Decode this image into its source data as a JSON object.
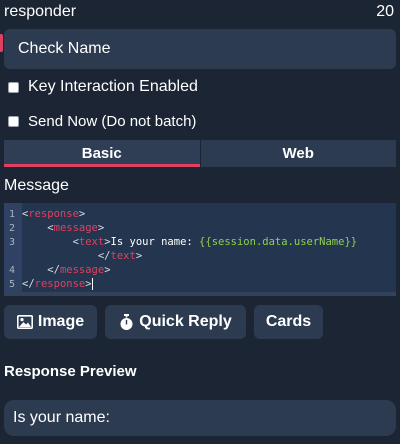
{
  "header": {
    "title": "responder",
    "count": "20"
  },
  "name_field": {
    "value": "Check Name"
  },
  "checkboxes": [
    {
      "label": "Key Interaction Enabled",
      "checked": false
    },
    {
      "label": "Send Now (Do not batch)",
      "checked": false
    }
  ],
  "tabs": [
    {
      "label": "Basic",
      "active": true
    },
    {
      "label": "Web",
      "active": false
    }
  ],
  "message": {
    "label": "Message",
    "lines": [
      {
        "num": "1",
        "open": "<",
        "tag": "response",
        "close": ">",
        "indent": ""
      },
      {
        "num": "2",
        "open": "<",
        "tag": "message",
        "close": ">",
        "indent": "    "
      },
      {
        "num": "3",
        "indent": "        ",
        "open": "<",
        "tag": "text",
        "close": ">",
        "text": "Is your name: ",
        "template": "{{session.data.userName}}"
      },
      {
        "num": "",
        "indent": "            ",
        "open": "</",
        "tag": "text",
        "close": ">"
      },
      {
        "num": "4",
        "indent": "    ",
        "open": "</",
        "tag": "message",
        "close": ">"
      },
      {
        "num": "5",
        "indent": "",
        "open": "</",
        "tag": "response",
        "close": ">"
      }
    ]
  },
  "buttons": {
    "image": "Image",
    "quick_reply": "Quick Reply",
    "cards": "Cards"
  },
  "preview": {
    "title": "Response Preview",
    "text": "Is your name:"
  },
  "colors": {
    "background": "#1c2534",
    "panel": "#2c3b50",
    "accent": "#e0405f",
    "editor_bg": "#24354f",
    "template_green": "#8fd14f"
  }
}
